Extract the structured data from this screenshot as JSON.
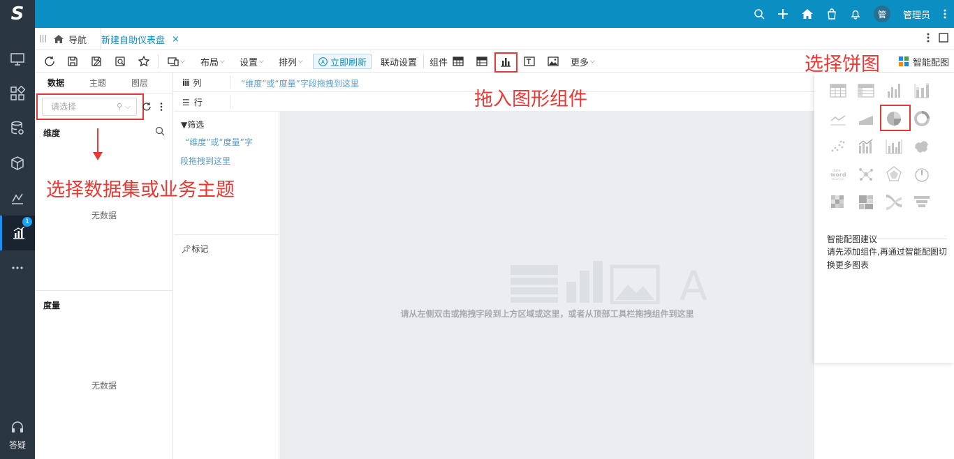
{
  "sidebar": {
    "logo": "S",
    "badge": "1",
    "help_label": "答疑"
  },
  "topbar": {
    "avatar_text": "管",
    "user_name": "管理员"
  },
  "tabs": {
    "nav_label": "导航",
    "active_label": "新建自助仪表盘",
    "close": "×"
  },
  "toolbar": {
    "layout": "布局",
    "settings": "设置",
    "arrange": "排列",
    "refresh": "立即刷新",
    "linkage": "联动设置",
    "components": "组件",
    "more": "更多",
    "smart_chart": "智能配图"
  },
  "datapanel": {
    "tabs": [
      "数据",
      "主题",
      "图层"
    ],
    "select_placeholder": "请选择",
    "dimension_title": "维度",
    "measure_title": "度量",
    "no_data_1": "无数据",
    "no_data_2": "无数据"
  },
  "shelves": {
    "columns_label": "列",
    "rows_label": "行",
    "drop_hint": "“维度”或“度量”字段拖拽到这里",
    "filter_label": "筛选",
    "filter_hint_1": "“维度”或“度量”字",
    "filter_hint_2": "段拖拽到这里",
    "mark_label": "标记"
  },
  "canvas": {
    "hint": "请从左侧双击或拖拽字段到上方区域或这里，或者从顶部工具栏拖拽组件到这里"
  },
  "chart_panel": {
    "suggestion_title": "智能配图建议",
    "suggestion_desc": "请先添加组件,再通过智能配图切换更多图表"
  },
  "annotations": {
    "drag_chart": "拖入图形组件",
    "select_pie": "选择饼图",
    "select_dataset": "选择数据集或业务主题"
  },
  "colors": {
    "topbar": "#0b8ec2",
    "rail": "#2b3643",
    "annotation": "#e53935"
  }
}
